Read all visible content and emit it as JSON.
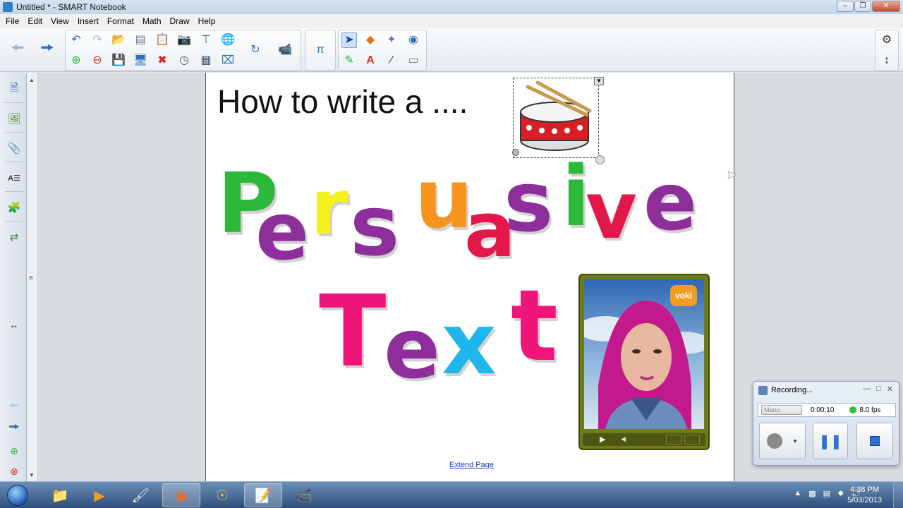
{
  "window": {
    "title": "Untitled * - SMART Notebook"
  },
  "menu": [
    "File",
    "Edit",
    "View",
    "Insert",
    "Format",
    "Math",
    "Draw",
    "Help"
  ],
  "page": {
    "heading": "How to write a ....",
    "word1": [
      "P",
      "e",
      "r",
      "s",
      "u",
      "a",
      "s",
      "i",
      "v",
      "e"
    ],
    "word2": [
      "T",
      "e",
      "x",
      "t"
    ],
    "extend_link": "Extend Page",
    "voki_logo": "voki"
  },
  "recording": {
    "title": "Recording...",
    "menu_label": "Menu",
    "time": "0:00:10",
    "fps": "8.0 fps"
  },
  "taskbar": {
    "clock_time": "4:38 PM",
    "clock_date": "5/03/2013"
  },
  "colors": {
    "green": "#2bb83b",
    "purple": "#8e2e9b",
    "yellow": "#f4f21a",
    "orange": "#f7941d",
    "red": "#e3184a",
    "pink": "#f0157a",
    "cyan": "#1fb6ec"
  }
}
